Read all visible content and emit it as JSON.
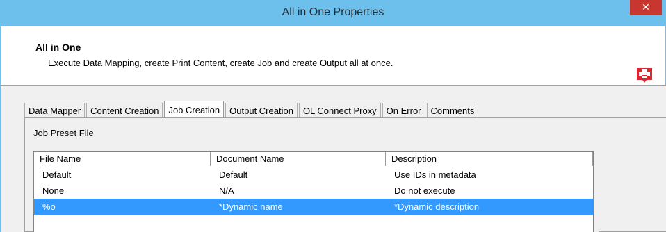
{
  "window": {
    "title": "All in One Properties",
    "close_glyph": "✕"
  },
  "header": {
    "title": "All in One",
    "description": "Execute Data Mapping, create Print Content, create Job and create Output all at once.",
    "icon": "printer-icon"
  },
  "tabs": [
    {
      "label": "Data Mapper",
      "active": false
    },
    {
      "label": "Content Creation",
      "active": false
    },
    {
      "label": "Job Creation",
      "active": true
    },
    {
      "label": "Output Creation",
      "active": false
    },
    {
      "label": "OL Connect Proxy",
      "active": false
    },
    {
      "label": "On Error",
      "active": false
    },
    {
      "label": "Comments",
      "active": false
    }
  ],
  "panel": {
    "label": "Job Preset File",
    "columns": [
      "File Name",
      "Document Name",
      "Description"
    ],
    "rows": [
      {
        "file": "Default",
        "document": "Default",
        "description": "Use IDs in metadata",
        "selected": false
      },
      {
        "file": "None",
        "document": "N/A",
        "description": "Do not execute",
        "selected": false
      },
      {
        "file": "%o",
        "document": "*Dynamic name",
        "description": "*Dynamic description",
        "selected": true
      }
    ]
  },
  "colors": {
    "titlebar": "#6ec0ec",
    "close": "#c7372f",
    "selection": "#3399ff",
    "icon": "#d7282f"
  }
}
